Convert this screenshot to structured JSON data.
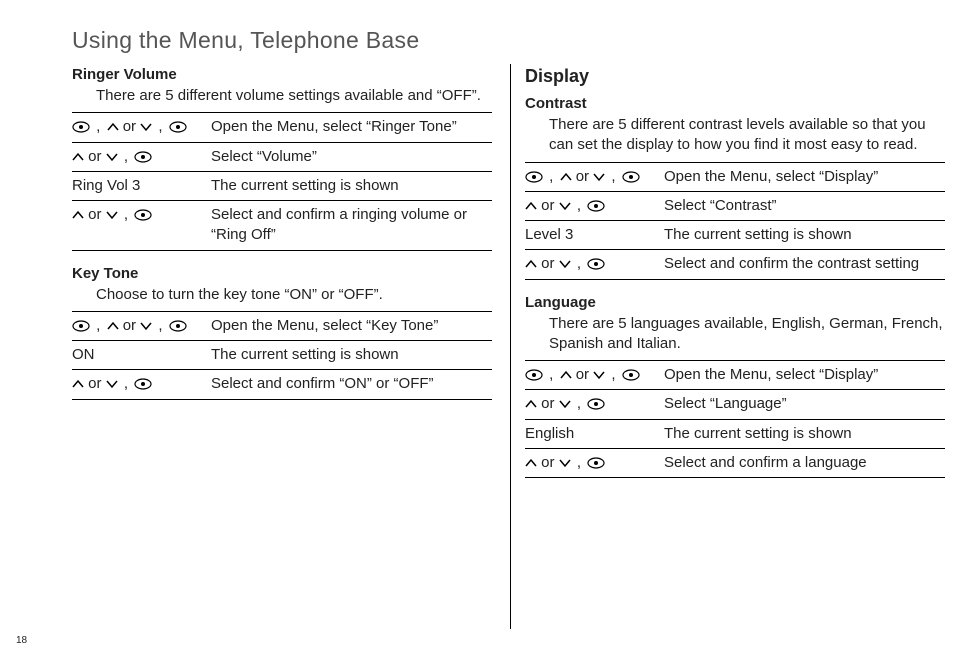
{
  "page_number": "18",
  "title": "Using the Menu, Telephone Base",
  "left": {
    "ringer": {
      "heading": "Ringer Volume",
      "intro": "There are 5 different volume settings available and “OFF”.",
      "rows": [
        {
          "keys": "menu,up_or_down,menu",
          "desc": "Open the Menu, select “Ringer Tone”"
        },
        {
          "keys": "up_or_down,menu",
          "desc": "Select “Volume”"
        },
        {
          "keys": "text:Ring Vol 3",
          "desc": "The current setting is shown"
        },
        {
          "keys": "up_or_down,menu",
          "desc": "Select and confirm a ringing volume or “Ring Off”"
        }
      ]
    },
    "keytone": {
      "heading": "Key Tone",
      "intro": "Choose to turn the key tone “ON” or “OFF”.",
      "rows": [
        {
          "keys": "menu,up_or_down,menu",
          "desc": "Open the Menu, select “Key Tone”"
        },
        {
          "keys": "text:ON",
          "desc": "The current setting is shown"
        },
        {
          "keys": "up_or_down,menu",
          "desc": "Select and confirm “ON” or “OFF”"
        }
      ]
    }
  },
  "right": {
    "display_heading": "Display",
    "contrast": {
      "heading": "Contrast",
      "intro": "There are 5 different contrast levels available so that you can set the display to how you find it most easy to read.",
      "rows": [
        {
          "keys": "menu,up_or_down,menu",
          "desc": "Open the Menu, select “Display”"
        },
        {
          "keys": "up_or_down,menu",
          "desc": "Select “Contrast”"
        },
        {
          "keys": "text:Level 3",
          "desc": "The current setting is shown"
        },
        {
          "keys": "up_or_down,menu",
          "desc": "Select and confirm the contrast setting"
        }
      ]
    },
    "language": {
      "heading": "Language",
      "intro": "There are 5 languages available, English, German, French, Spanish and Italian.",
      "rows": [
        {
          "keys": "menu,up_or_down,menu",
          "desc": "Open the Menu, select “Display”"
        },
        {
          "keys": "up_or_down,menu",
          "desc": "Select “Language”"
        },
        {
          "keys": "text:English",
          "desc": "The current setting is shown"
        },
        {
          "keys": "up_or_down,menu",
          "desc": "Select and confirm a language"
        }
      ]
    }
  },
  "labels": {
    "or": "or"
  }
}
